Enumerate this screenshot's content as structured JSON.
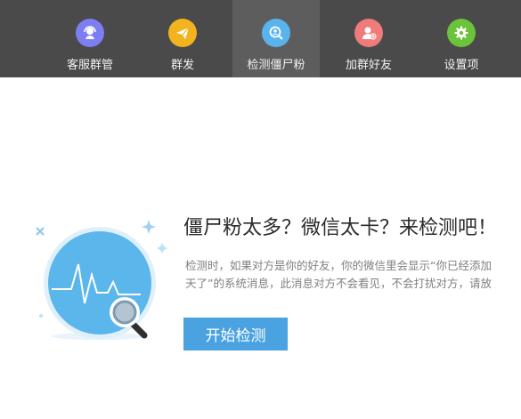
{
  "nav": {
    "tabs": [
      {
        "label": "客服群管",
        "icon": "customer-service-icon",
        "color": "#7d7ef2"
      },
      {
        "label": "群发",
        "icon": "paper-plane-icon",
        "color": "#f3b31f"
      },
      {
        "label": "检测僵尸粉",
        "icon": "search-user-icon",
        "color": "#59b3ec",
        "active": true
      },
      {
        "label": "加群好友",
        "icon": "add-friend-icon",
        "color": "#ef7b7b"
      },
      {
        "label": "设置项",
        "icon": "gear-icon",
        "color": "#6cc33b"
      }
    ]
  },
  "main": {
    "headline": "僵尸粉太多？微信太卡？来检测吧！",
    "description_line1": "检测时，如果对方是你的好友，你的微信里会显示“你已经添加",
    "description_line2": "天了”的系统消息，此消息对方不会看见，不会打扰对方，请放",
    "start_button": "开始检测"
  },
  "colors": {
    "topbar": "#4a4a4a",
    "active_tab": "#5d5d5d",
    "accent": "#4aa3e0"
  }
}
